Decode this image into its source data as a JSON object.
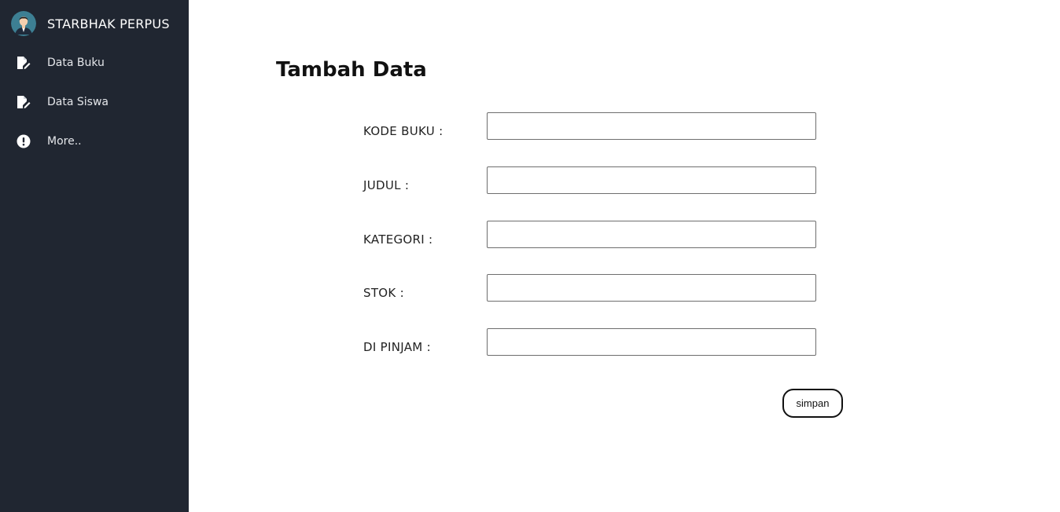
{
  "sidebar": {
    "brand": {
      "title": "STARBHAK PERPUS",
      "avatar_icon": "user-avatar-icon"
    },
    "items": [
      {
        "label": "Data Buku",
        "icon": "edit-document-icon"
      },
      {
        "label": "Data Siswa",
        "icon": "edit-document-icon"
      },
      {
        "label": "More..",
        "icon": "exclamation-circle-icon"
      }
    ]
  },
  "main": {
    "title": "Tambah Data",
    "fields": [
      {
        "label": "KODE BUKU :",
        "value": "",
        "placeholder": ""
      },
      {
        "label": "JUDUL :",
        "value": "",
        "placeholder": ""
      },
      {
        "label": "KATEGORI :",
        "value": "",
        "placeholder": ""
      },
      {
        "label": "STOK :",
        "value": "",
        "placeholder": ""
      },
      {
        "label": "DI PINJAM :",
        "value": "",
        "placeholder": ""
      }
    ],
    "submit_label": "simpan"
  },
  "colors": {
    "sidebar_bg": "#202631",
    "sidebar_text": "#ffffff",
    "page_bg": "#ffffff",
    "input_border": "#6e6e6e",
    "button_border": "#111111"
  }
}
